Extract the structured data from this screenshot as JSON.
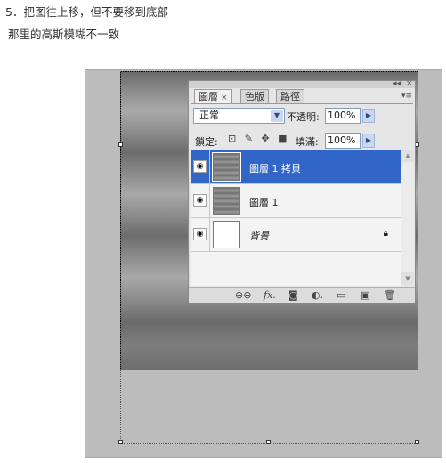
{
  "instructions": {
    "line1": "5．把图往上移，但不要移到底部",
    "line2": "那里的高斯模糊不一致"
  },
  "panel": {
    "tabs": [
      {
        "label": "圖層",
        "close": "×"
      },
      {
        "label": "色版"
      },
      {
        "label": "路徑"
      }
    ],
    "window_controls": {
      "collapse": "◂◂",
      "close": "×"
    },
    "menu_icon": "▾≡",
    "blend_mode": "正常",
    "opacity_label": "不透明:",
    "opacity_value": "100%",
    "lock_label": "鎖定:",
    "lock_icons": [
      "transparent-pixels-icon",
      "brush-icon",
      "move-icon",
      "lock-icon"
    ],
    "lock_glyphs": "⊡ ✎ ✥ ■",
    "fill_label": "填滿:",
    "fill_value": "100%",
    "layers": [
      {
        "name": "圖層 1 拷貝",
        "selected": true,
        "visible": true,
        "eye": "◉"
      },
      {
        "name": "圖層 1",
        "selected": false,
        "visible": true,
        "eye": "◉"
      },
      {
        "name": "背景",
        "selected": false,
        "visible": true,
        "eye": "◉",
        "locked": true,
        "lock_glyph": "🔒︎"
      }
    ],
    "bottom_icons": [
      "link-icon",
      "fx-icon",
      "mask-icon",
      "adjustment-icon",
      "group-folder-icon",
      "new-layer-icon",
      "trash-icon"
    ],
    "bottom_glyphs": {
      "link": "⊖⊖",
      "fx": "fx.",
      "mask": "◙",
      "adjust": "◐.",
      "folder": "▭",
      "newlayer": "▣",
      "trash": "🗑︎"
    }
  },
  "colors": {
    "selection": "#3166c8",
    "canvas_bg": "#bcbcbc"
  }
}
